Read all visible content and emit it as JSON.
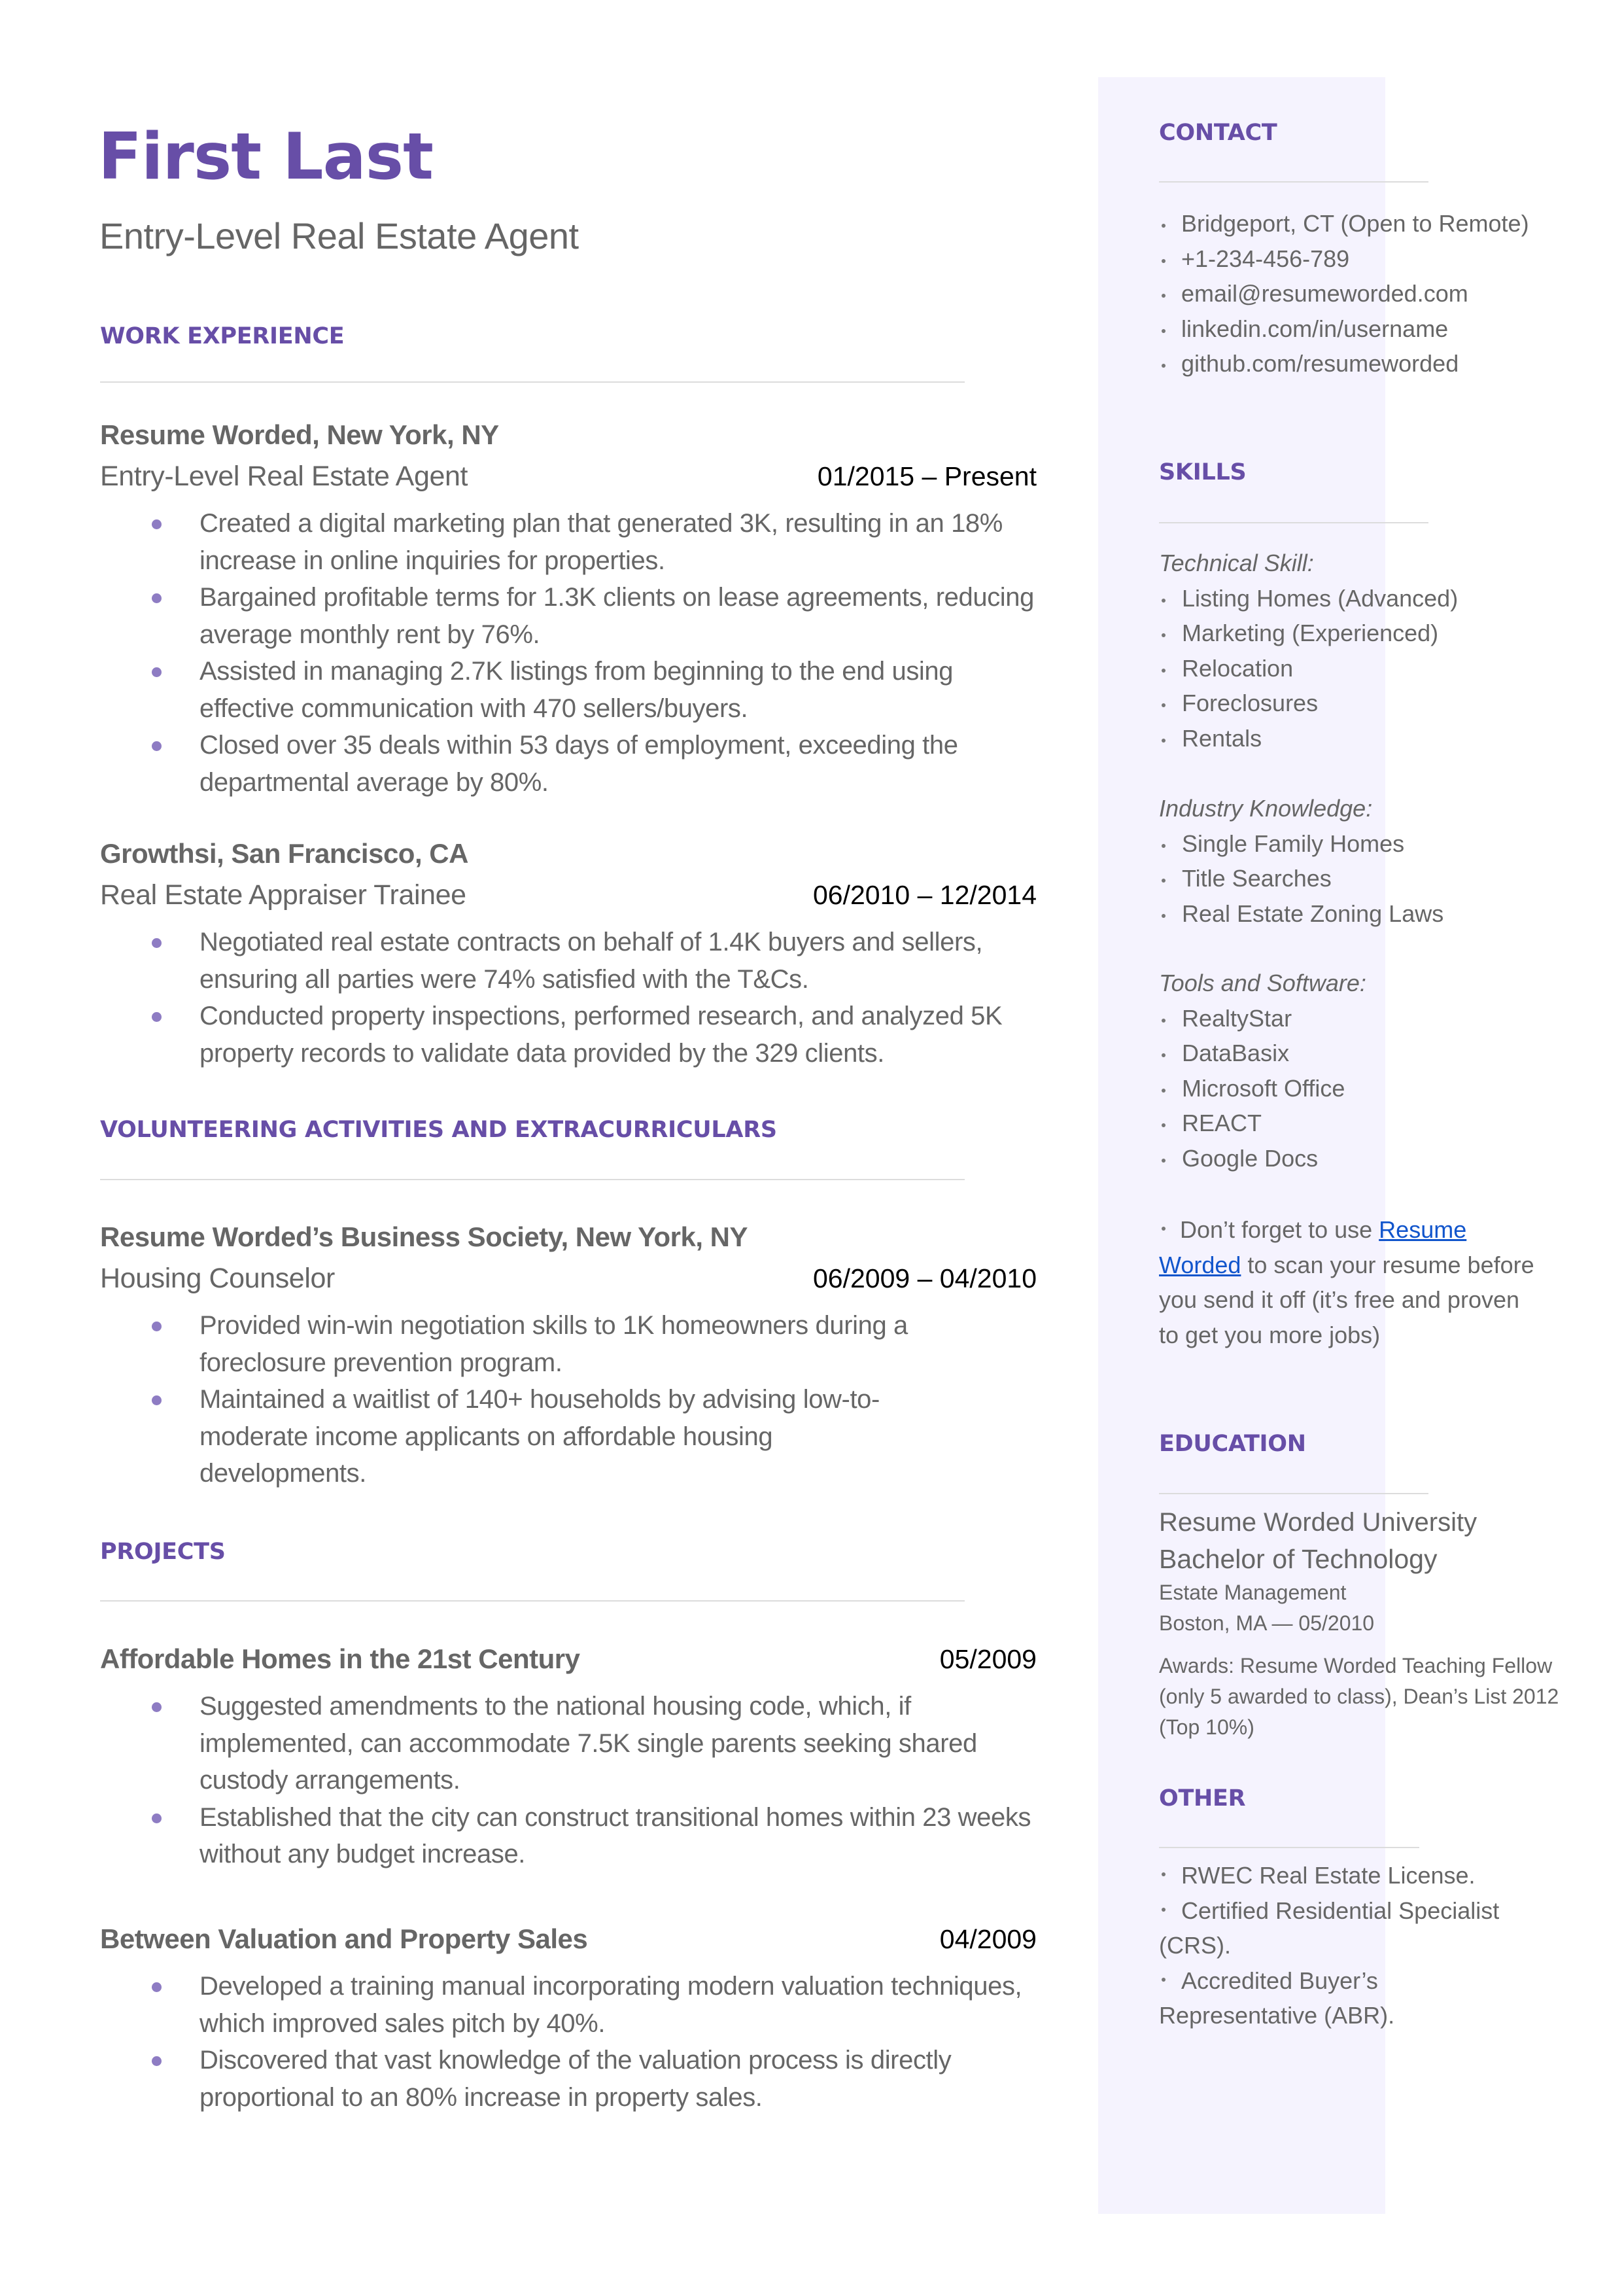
{
  "header": {
    "name": "First Last",
    "title": "Entry-Level Real Estate Agent"
  },
  "colors": {
    "accent": "#674ea7",
    "bullet": "#8e7cc3",
    "sidebar_bg": "#f5f3fe",
    "body_text": "#666666",
    "link": "#1155cc"
  },
  "main": {
    "work_experience": {
      "title": "WORK EXPERIENCE",
      "entries": [
        {
          "org": "Resume Worded, New York, NY",
          "role": "Entry-Level Real Estate Agent",
          "date": "01/2015 – Present",
          "bullets": [
            "Created a digital marketing plan that generated 3K, resulting in an 18% increase in online inquiries for properties.",
            "Bargained profitable terms for 1.3K clients on lease agreements, reducing average monthly rent by 76%.",
            "Assisted in managing 2.7K listings from beginning to the end using effective communication with 470 sellers/buyers.",
            "Closed over 35 deals within 53 days of employment, exceeding the departmental average by 80%."
          ]
        },
        {
          "org": "Growthsi, San Francisco, CA",
          "role": "Real Estate Appraiser Trainee",
          "date": "06/2010 – 12/2014",
          "bullets": [
            "Negotiated real estate contracts on behalf of 1.4K buyers and sellers, ensuring all parties were 74% satisfied with the T&Cs.",
            "Conducted property inspections, performed research, and analyzed 5K property records to validate data provided by the 329 clients."
          ]
        }
      ]
    },
    "volunteering": {
      "title": "VOLUNTEERING ACTIVITIES AND EXTRACURRICULARS",
      "entries": [
        {
          "org": "Resume Worded’s Business Society, New York, NY",
          "role": "Housing Counselor",
          "date": "06/2009 – 04/2010",
          "bullets": [
            "Provided win-win negotiation skills to 1K homeowners during a foreclosure prevention program.",
            "Maintained a waitlist of 140+ households by advising low-to-moderate income applicants on affordable housing developments."
          ]
        }
      ]
    },
    "projects": {
      "title": "PROJECTS",
      "entries": [
        {
          "name": "Affordable Homes in the 21st Century",
          "date": "05/2009",
          "bullets": [
            "Suggested amendments to the national housing code, which, if implemented, can accommodate 7.5K single parents seeking shared custody arrangements.",
            "Established that the city can construct transitional homes within 23 weeks without any budget increase."
          ]
        },
        {
          "name": "Between Valuation and Property Sales",
          "date": "04/2009",
          "bullets": [
            "Developed a training manual incorporating modern valuation techniques, which improved sales pitch by 40%.",
            "Discovered that vast knowledge of the valuation process is directly proportional to an 80% increase in property sales."
          ]
        }
      ]
    }
  },
  "sidebar": {
    "contact": {
      "title": "CONTACT",
      "items": [
        " Bridgeport, CT (Open to Remote)",
        "+1-234-456-789",
        "email@resumeworded.com",
        "linkedin.com/in/username",
        "github.com/resumeworded"
      ]
    },
    "skills": {
      "title": "SKILLS",
      "groups": [
        {
          "label": "Technical Skill:",
          "items": [
            "Listing Homes (Advanced)",
            "Marketing (Experienced)",
            "Relocation",
            "Foreclosures",
            "Rentals"
          ]
        },
        {
          "label": "Industry Knowledge:",
          "items": [
            "Single Family Homes",
            "Title Searches",
            "Real Estate Zoning Laws"
          ]
        },
        {
          "label": "Tools and Software:",
          "items": [
            "RealtyStar",
            "DataBasix",
            "Microsoft Office",
            "REACT",
            "Google Docs"
          ]
        }
      ],
      "note": {
        "prefix": "Don’t forget to use ",
        "link_text": "Resume Worded",
        "suffix": " to scan your resume before you send it off (it’s free and proven to get you more jobs)"
      }
    },
    "education": {
      "title": "EDUCATION",
      "school": "Resume Worded University",
      "degree": "Bachelor of Technology",
      "field": "Estate Management",
      "location_date": "Boston, MA — 05/2010",
      "awards": "Awards: Resume Worded Teaching Fellow (only 5 awarded to class), Dean’s List 2012 (Top 10%)"
    },
    "other": {
      "title": "OTHER",
      "items": [
        "RWEC Real Estate License.",
        "Certified Residential Specialist (CRS).",
        "Accredited Buyer’s Representative (ABR)."
      ]
    }
  }
}
